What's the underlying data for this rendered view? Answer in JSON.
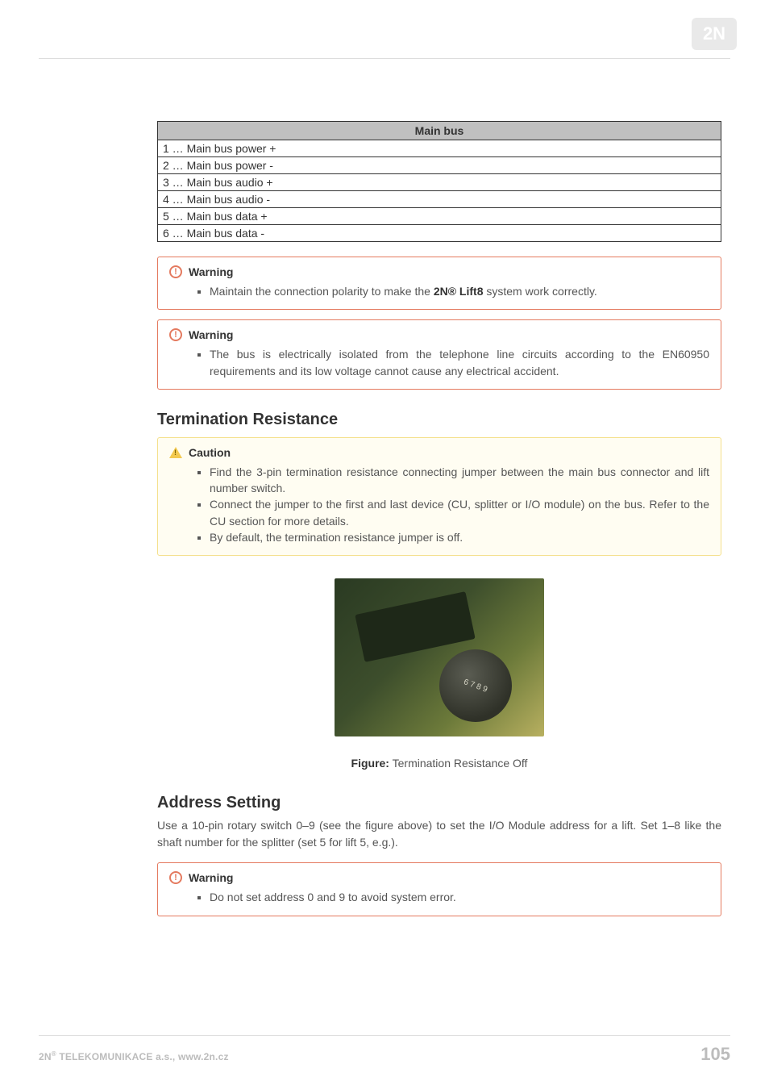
{
  "table": {
    "header": "Main bus",
    "rows": [
      "1 … Main bus power +",
      "2 … Main bus power -",
      "3 … Main bus audio +",
      "4 … Main bus audio -",
      "5 … Main bus data +",
      "6 … Main bus data -"
    ]
  },
  "callouts": [
    {
      "title": "Warning",
      "items": [
        {
          "pre": "Maintain the connection polarity to make the ",
          "bold": "2N® Lift8",
          "post": " system work correctly."
        }
      ]
    },
    {
      "title": "Warning",
      "items": [
        "The bus is electrically isolated from the telephone line circuits according to the EN60950 requirements and its low voltage cannot cause any electrical accident."
      ]
    },
    {
      "title": "Caution",
      "items": [
        "Find the 3-pin termination resistance connecting jumper between the main bus connector and lift number switch.",
        "Connect the jumper to the first and last device (CU, splitter or I/O module) on the bus. Refer to the CU section for more details.",
        "By default, the termination resistance jumper is off."
      ]
    },
    {
      "title": "Warning",
      "items": [
        "Do not set address 0 and 9 to avoid system error."
      ]
    }
  ],
  "sections": {
    "termination": "Termination Resistance",
    "address": "Address Setting"
  },
  "figure": {
    "label": "Figure:",
    "caption": "Termination Resistance Off"
  },
  "address_para": "Use a 10-pin rotary switch 0–9 (see the figure above) to set the I/O Module address for a lift. Set 1–8 like the shaft number for the splitter (set 5 for lift 5, e.g.).",
  "footer": {
    "company_pre": "2N",
    "company_sup": "®",
    "company_post": "TELEKOMUNIKACE a.s., www.2n.cz",
    "page": "105"
  }
}
